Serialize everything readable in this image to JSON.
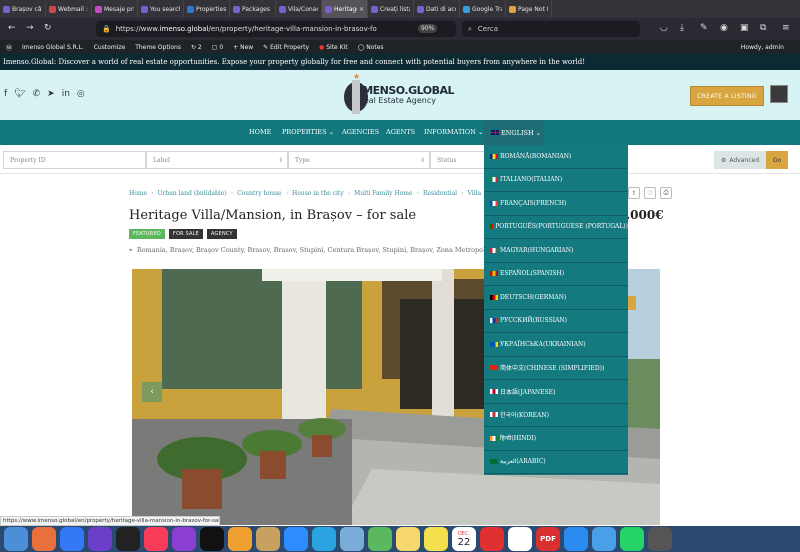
{
  "browser": {
    "tabs": [
      {
        "label": "Brașov câtre"
      },
      {
        "label": "Webmail :: S"
      },
      {
        "label": "Mesaje prim"
      },
      {
        "label": "You searche"
      },
      {
        "label": "Properties ‹"
      },
      {
        "label": "Packages ‹ i"
      },
      {
        "label": "Vila/Conac c"
      },
      {
        "label": "Heritage",
        "active": true
      },
      {
        "label": "Creați listare"
      },
      {
        "label": "Dati di acces"
      },
      {
        "label": "Google Trad"
      },
      {
        "label": "Page Not Fo"
      }
    ],
    "url_prefix": "https://www.",
    "url_domain": "imenso.global",
    "url_path": "/en/property/heritage-villa-mansion-in-brasov-fo",
    "zoom": "90%",
    "search_placeholder": "Cerca"
  },
  "adminbar": {
    "site": "Imenso Global S.R.L.",
    "customize": "Customize",
    "theme_options": "Theme Options",
    "comments_count": "2",
    "updates_count": "0",
    "new": "+ New",
    "edit_property": "Edit Property",
    "site_kit": "Site Kit",
    "notes": "Notes",
    "howdy": "Howdy, admin"
  },
  "announcement": "Imenso.Global: Discover a world of real estate opportunities. Expose your property globally for free and connect with potential buyers from anywhere in the world!",
  "header": {
    "logo_line1": "IMENSO.GLOBAL",
    "logo_line2": "Real Estate Agency",
    "create_listing": "CREATE A LISTING"
  },
  "nav": {
    "home": "HOME",
    "properties": "PROPERTIES",
    "agencies": "AGENCIES",
    "agents": "AGENTS",
    "information": "INFORMATION",
    "language": "ENGLISH",
    "chevron": "⌄"
  },
  "search": {
    "property_id": "Property ID",
    "label": "Label",
    "type": "Type",
    "status": "Status",
    "advanced": "Advanced",
    "go": "Go"
  },
  "breadcrumb": [
    "Home",
    "Urban land (buildable)",
    "Country house",
    "House in the city",
    "Multi Family Home",
    "Residential",
    "Villa",
    "Herita"
  ],
  "property": {
    "title": "Heritage Villa/Mansion, in Brașov – for sale",
    "price": ".000€",
    "badges": [
      {
        "label": "FEATURED",
        "color": "#5cb85c"
      },
      {
        "label": "FOR SALE",
        "color": "#333333"
      },
      {
        "label": "AGENCY",
        "color": "#333333"
      }
    ],
    "address": "Romania, Brașov, Brașov County, Brasov, Brasov, Stupini, Centura Brașov, Stupini, Brașov, Zona Metropolita"
  },
  "languages": [
    {
      "label": "ROMÂNĂ(ROMANIAN)",
      "flag": [
        "#002b7f",
        "#fcd116",
        "#ce1126"
      ]
    },
    {
      "label": "ITALIANO(ITALIAN)",
      "flag": [
        "#009246",
        "#ffffff",
        "#ce2b37"
      ]
    },
    {
      "label": "FRANÇAIS(FRENCH)",
      "flag": [
        "#0055a4",
        "#ffffff",
        "#ef4135"
      ]
    },
    {
      "label": "PORTUGUÊS(PORTUGUESE (PORTUGAL))",
      "flag": [
        "#006600",
        "#ff0000",
        "#ff0000"
      ]
    },
    {
      "label": "MAGYAR(HUNGARIAN)",
      "flag": [
        "#ce2939",
        "#ffffff",
        "#477050"
      ]
    },
    {
      "label": "ESPAÑOL(SPANISH)",
      "flag": [
        "#aa151b",
        "#f1bf00",
        "#aa151b"
      ]
    },
    {
      "label": "DEUTSCH(GERMAN)",
      "flag": [
        "#000000",
        "#dd0000",
        "#ffce00"
      ]
    },
    {
      "label": "РУССКИЙ(RUSSIAN)",
      "flag": [
        "#ffffff",
        "#0039a6",
        "#d52b1e"
      ]
    },
    {
      "label": "УКРАЇНСЬКА(UKRAINIAN)",
      "flag": [
        "#0057b7",
        "#0057b7",
        "#ffd700"
      ]
    },
    {
      "label": "简体中文(CHINESE (SIMPLIFIED))",
      "flag": [
        "#de2910",
        "#de2910",
        "#de2910"
      ]
    },
    {
      "label": "日本語(JAPANESE)",
      "flag": [
        "#ffffff",
        "#bc002d",
        "#ffffff"
      ]
    },
    {
      "label": "한국어(KOREAN)",
      "flag": [
        "#ffffff",
        "#cd2e3a",
        "#ffffff"
      ]
    },
    {
      "label": "हिन्दी(HINDI)",
      "flag": [
        "#ff9933",
        "#ffffff",
        "#138808"
      ]
    },
    {
      "label": "العربية(ARABIC)",
      "flag": [
        "#006c35",
        "#006c35",
        "#006c35"
      ]
    }
  ],
  "status_url": "https://www.imenso.global/en/property/heritage-villa-mansion-in-brasov-for-sale/",
  "dock": {
    "calendar_month": "DEC.",
    "calendar_day": "22",
    "pdf": "PDF",
    "icons": [
      "finder-icon",
      "firefox-icon",
      "safari-icon",
      "podcast-icon",
      "siri-icon",
      "music-icon",
      "podcasts-icon",
      "appletv-icon",
      "home-icon",
      "chess-icon",
      "zoom-icon",
      "telegram-icon",
      "preview-icon",
      "maps-icon",
      "notes-icon",
      "stickies-icon",
      "calendar-icon",
      "spark-icon",
      "reminders-icon",
      "pdf-icon",
      "appstore-icon",
      "folder-icon",
      "whatsapp-icon",
      "more-icon"
    ]
  },
  "colors": {
    "teal": "#13787e",
    "header_bg": "#d8f3f4",
    "gold": "#d8a540",
    "dropdown_bg": "#157a80"
  }
}
